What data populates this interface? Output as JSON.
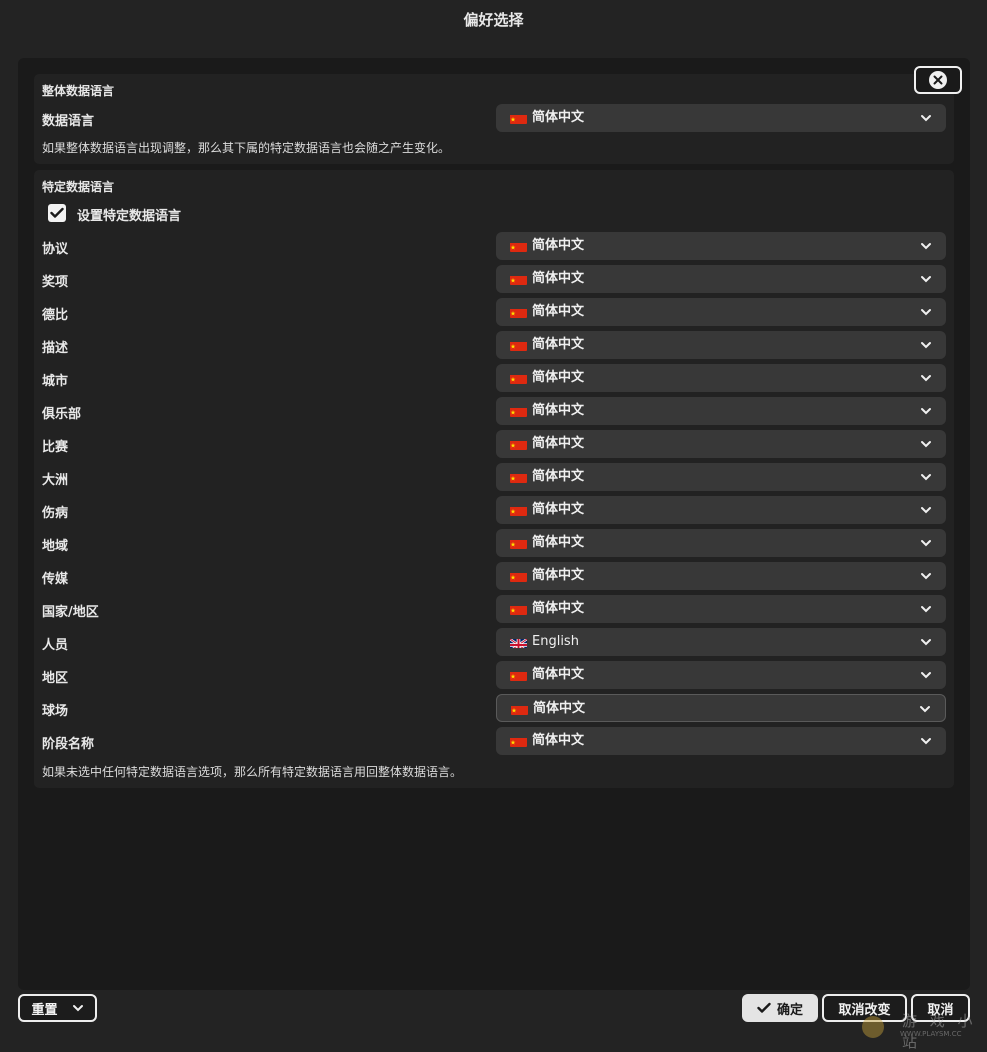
{
  "window": {
    "title": "偏好选择"
  },
  "general": {
    "section_title": "整体数据语言",
    "label": "数据语言",
    "value": "简体中文",
    "flag": "cn-flag-icon",
    "note": "如果整体数据语言出现调整，那么其下属的特定数据语言也会随之产生变化。"
  },
  "specific": {
    "section_title": "特定数据语言",
    "checkbox_label": "设置特定数据语言",
    "checkbox_checked": true,
    "rows": [
      {
        "label": "协议",
        "value": "简体中文",
        "flag": "cn"
      },
      {
        "label": "奖项",
        "value": "简体中文",
        "flag": "cn"
      },
      {
        "label": "德比",
        "value": "简体中文",
        "flag": "cn"
      },
      {
        "label": "描述",
        "value": "简体中文",
        "flag": "cn"
      },
      {
        "label": "城市",
        "value": "简体中文",
        "flag": "cn"
      },
      {
        "label": "俱乐部",
        "value": "简体中文",
        "flag": "cn"
      },
      {
        "label": "比赛",
        "value": "简体中文",
        "flag": "cn"
      },
      {
        "label": "大洲",
        "value": "简体中文",
        "flag": "cn"
      },
      {
        "label": "伤病",
        "value": "简体中文",
        "flag": "cn"
      },
      {
        "label": "地域",
        "value": "简体中文",
        "flag": "cn"
      },
      {
        "label": "传媒",
        "value": "简体中文",
        "flag": "cn"
      },
      {
        "label": "国家/地区",
        "value": "简体中文",
        "flag": "cn"
      },
      {
        "label": "人员",
        "value": "English",
        "flag": "uk"
      },
      {
        "label": "地区",
        "value": "简体中文",
        "flag": "cn"
      },
      {
        "label": "球场",
        "value": "简体中文",
        "flag": "cn"
      },
      {
        "label": "阶段名称",
        "value": "简体中文",
        "flag": "cn"
      }
    ],
    "note": "如果未选中任何特定数据语言选项，那么所有特定数据语言用回整体数据语言。"
  },
  "footer": {
    "reset_label": "重置",
    "ok_label": "确定",
    "revert_label": "取消改变",
    "cancel_label": "取消"
  },
  "watermark": {
    "big": "游 戏 小 站",
    "small": "WWW.PLAYSM.CC"
  },
  "colors": {
    "background": "#232323",
    "panel": "#1a1a1a",
    "section": "#222222",
    "select": "#383838",
    "cn_red": "#de2910",
    "cn_star": "#ffde00"
  }
}
